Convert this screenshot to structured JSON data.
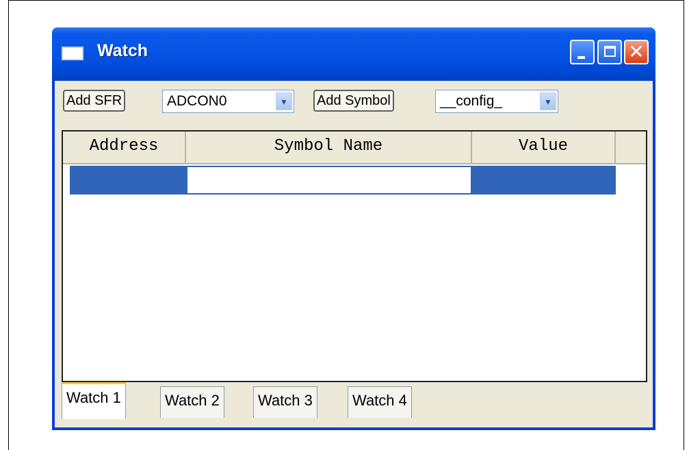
{
  "window": {
    "title": "Watch"
  },
  "toolbar": {
    "add_sfr_label": "Add SFR",
    "sfr_select_value": "ADCON0",
    "add_symbol_label": "Add Symbol",
    "symbol_select_value": "__config_"
  },
  "grid": {
    "columns": [
      "Address",
      "Symbol Name",
      "Value"
    ],
    "rows": [
      {
        "address": "",
        "symbol_name": "",
        "value": ""
      }
    ]
  },
  "tabs": [
    "Watch 1",
    "Watch 2",
    "Watch 3",
    "Watch 4"
  ],
  "colors": {
    "titlebar": "#0756e6",
    "selection": "#3165b9",
    "client_bg": "#ece9d8",
    "active_tab_accent": "#ffc83c"
  }
}
